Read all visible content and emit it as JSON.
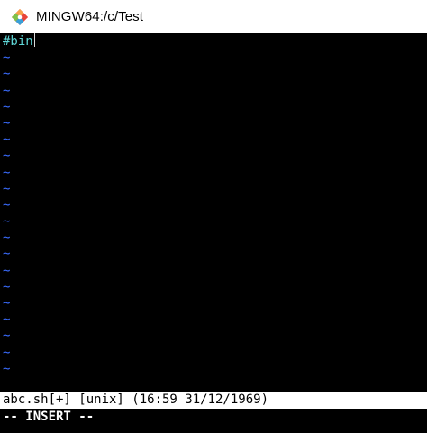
{
  "window": {
    "title": "MINGW64:/c/Test",
    "icon": "git-bash-diamond-icon"
  },
  "editor": {
    "lines": [
      "#bin"
    ],
    "empty_line_marker": "~",
    "empty_line_count": 20,
    "text_color": "#5fd7d7",
    "tilde_color": "#3a6cff"
  },
  "status_line": "abc.sh[+] [unix] (16:59 31/12/1969)",
  "mode_line": "-- INSERT --"
}
